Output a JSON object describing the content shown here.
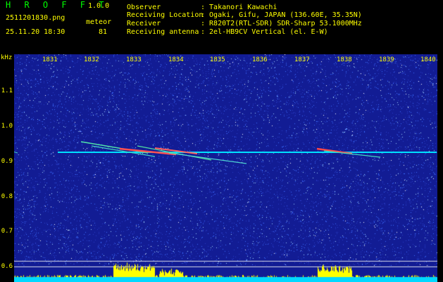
{
  "header": {
    "app_title": "H R O F F T",
    "version": "1.0.0",
    "filename": "2511201830.png",
    "meteor_label": "meteor",
    "datetime": "25.11.20 18:30",
    "meteor_count": "81",
    "info": [
      {
        "label": "Observer",
        "value": ": Takanori Kawachi"
      },
      {
        "label": "Receiving Location",
        "value": ": Ogaki, Gifu, JAPAN (136.60E, 35.35N)"
      },
      {
        "label": "Receiver",
        "value": ": R820T2(RTL-SDR) SDR-Sharp 53.1000MHz"
      },
      {
        "label": "Receiving antenna",
        "value": ": 2el-HB9CV Vertical (el. E-W)"
      }
    ]
  },
  "axes": {
    "y_unit": "kHz",
    "y_ticks": [
      "1.1",
      "1.0",
      "0.9",
      "0.8",
      "0.7",
      "0.6"
    ],
    "x_ticks": [
      "1831",
      "1832",
      "1833",
      "1834",
      "1835",
      "1836",
      "1837",
      "1838",
      "1839",
      "1840"
    ]
  },
  "colors": {
    "background": "#000000",
    "plot_bg": "#121c94",
    "label": "#ffff00",
    "title": "#00ff00",
    "carrier": "#00e0ff"
  }
}
